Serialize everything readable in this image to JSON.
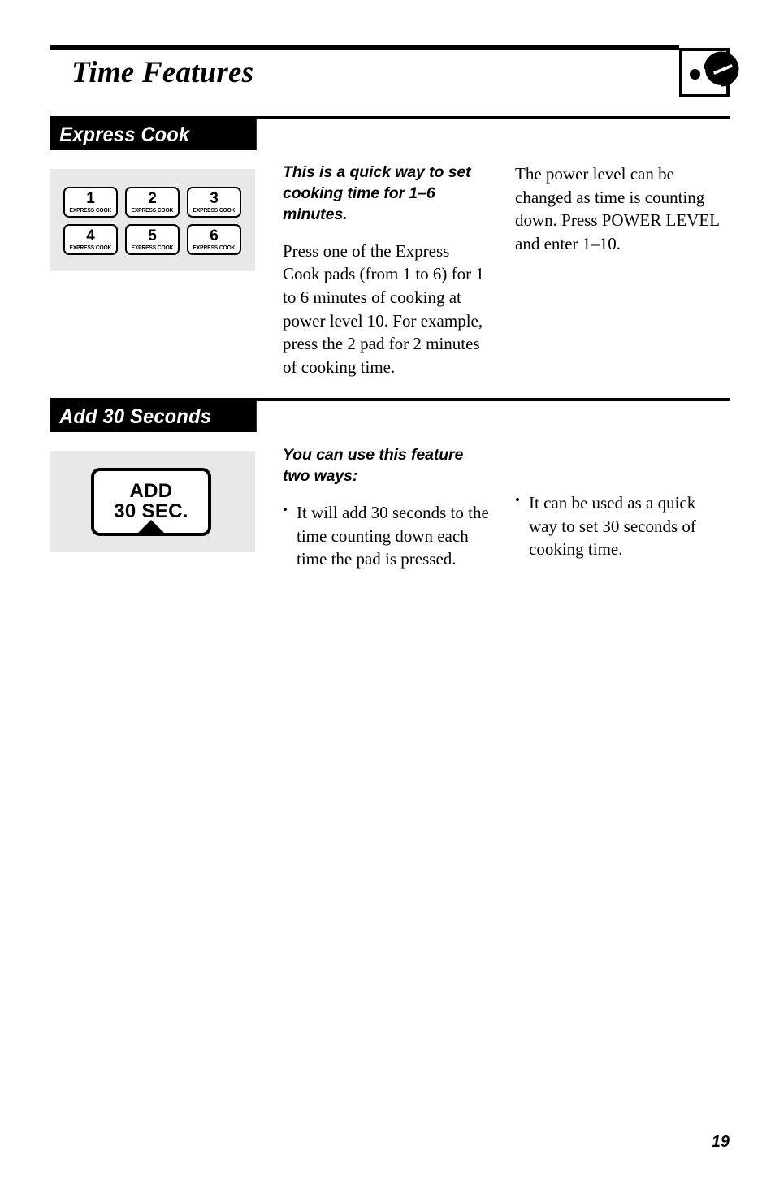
{
  "page": {
    "title": "Time Features",
    "number": "19",
    "corner_icon": "microwave-dial-icon"
  },
  "sections": [
    {
      "id": "express-cook",
      "heading": "Express Cook",
      "keypad": {
        "keys": [
          {
            "num": "1",
            "label": "EXPRESS COOK"
          },
          {
            "num": "2",
            "label": "EXPRESS COOK"
          },
          {
            "num": "3",
            "label": "EXPRESS COOK"
          },
          {
            "num": "4",
            "label": "EXPRESS COOK"
          },
          {
            "num": "5",
            "label": "EXPRESS COOK"
          },
          {
            "num": "6",
            "label": "EXPRESS COOK"
          }
        ]
      },
      "column_mid": {
        "lead": "This is a quick way to set cooking time for 1–6 minutes.",
        "body": "Press one of the Express Cook pads (from 1 to 6) for 1 to 6 minutes of cooking at power level 10. For example, press the 2 pad for 2 minutes of cooking time."
      },
      "column_right": {
        "body": "The power level can be changed as time is counting down. Press POWER LEVEL and enter 1–10."
      }
    },
    {
      "id": "add-30-seconds",
      "heading": "Add 30 Seconds",
      "keypad": {
        "key_line1": "ADD",
        "key_line2": "30 SEC."
      },
      "column_mid": {
        "lead": "You can use this feature two ways:",
        "bullet": "It will add 30 seconds to the time counting down each time the pad is pressed."
      },
      "column_right": {
        "bullet": "It can be used as a quick way to set 30 seconds of cooking time."
      }
    }
  ],
  "colors": {
    "bar_bg": "#000000",
    "bar_text": "#ffffff",
    "art_panel_bg": "#e8e8e8",
    "text": "#000000"
  }
}
